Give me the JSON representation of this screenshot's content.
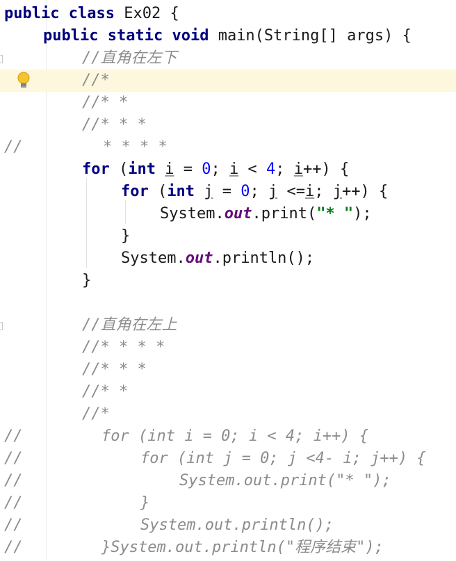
{
  "editor": {
    "lines": [
      {
        "tokens": [
          {
            "t": "public",
            "c": "kw"
          },
          {
            "t": " "
          },
          {
            "t": "class",
            "c": "kw"
          },
          {
            "t": " Ex02 {"
          }
        ]
      },
      {
        "tokens": [
          {
            "t": "public",
            "c": "kw"
          },
          {
            "t": " "
          },
          {
            "t": "static",
            "c": "kw"
          },
          {
            "t": " "
          },
          {
            "t": "void",
            "c": "kw"
          },
          {
            "t": " main(String[] args) {"
          }
        ]
      },
      {
        "tokens": [
          {
            "t": "//直角在左下",
            "c": "comment"
          }
        ]
      },
      {
        "tokens": [
          {
            "t": "//*",
            "c": "comment"
          }
        ]
      },
      {
        "tokens": [
          {
            "t": "//* *",
            "c": "comment"
          }
        ]
      },
      {
        "tokens": [
          {
            "t": "//* * *",
            "c": "comment"
          }
        ]
      },
      {
        "tokens": [
          {
            "t": "* * * *",
            "c": "comment"
          }
        ]
      },
      {
        "tokens": [
          {
            "t": "for",
            "c": "kw"
          },
          {
            "t": " ("
          },
          {
            "t": "int",
            "c": "kw"
          },
          {
            "t": " "
          },
          {
            "t": "i",
            "c": "uline"
          },
          {
            "t": " = "
          },
          {
            "t": "0",
            "c": "num"
          },
          {
            "t": "; "
          },
          {
            "t": "i",
            "c": "uline"
          },
          {
            "t": " < "
          },
          {
            "t": "4",
            "c": "num"
          },
          {
            "t": "; "
          },
          {
            "t": "i",
            "c": "uline"
          },
          {
            "t": "++) {"
          }
        ]
      },
      {
        "tokens": [
          {
            "t": "for",
            "c": "kw"
          },
          {
            "t": " ("
          },
          {
            "t": "int",
            "c": "kw"
          },
          {
            "t": " "
          },
          {
            "t": "j",
            "c": "uline"
          },
          {
            "t": " = "
          },
          {
            "t": "0",
            "c": "num"
          },
          {
            "t": "; "
          },
          {
            "t": "j",
            "c": "uline"
          },
          {
            "t": " <="
          },
          {
            "t": "i",
            "c": "uline"
          },
          {
            "t": "; "
          },
          {
            "t": "j",
            "c": "uline"
          },
          {
            "t": "++) {"
          }
        ]
      },
      {
        "tokens": [
          {
            "t": "System."
          },
          {
            "t": "out",
            "c": "field"
          },
          {
            "t": ".print("
          },
          {
            "t": "\"* \"",
            "c": "str"
          },
          {
            "t": ");"
          }
        ]
      },
      {
        "tokens": [
          {
            "t": "}"
          }
        ]
      },
      {
        "tokens": [
          {
            "t": "System."
          },
          {
            "t": "out",
            "c": "field"
          },
          {
            "t": ".println();"
          }
        ]
      },
      {
        "tokens": [
          {
            "t": "}"
          }
        ]
      },
      {
        "tokens": []
      },
      {
        "tokens": [
          {
            "t": "//直角在左上",
            "c": "comment"
          }
        ]
      },
      {
        "tokens": [
          {
            "t": "//* * * *",
            "c": "comment"
          }
        ]
      },
      {
        "tokens": [
          {
            "t": "//* * *",
            "c": "comment"
          }
        ]
      },
      {
        "tokens": [
          {
            "t": "//* *",
            "c": "comment"
          }
        ]
      },
      {
        "tokens": [
          {
            "t": "//*",
            "c": "comment"
          }
        ]
      },
      {
        "tokens": [
          {
            "t": "for (int i = 0; i < 4; i++) {",
            "c": "comment"
          }
        ]
      },
      {
        "tokens": [
          {
            "t": "for (int j = 0; j <4- i; j++) {",
            "c": "comment"
          }
        ]
      },
      {
        "tokens": [
          {
            "t": "System.out.print(\"* \");",
            "c": "comment"
          }
        ]
      },
      {
        "tokens": [
          {
            "t": "}",
            "c": "comment"
          }
        ]
      },
      {
        "tokens": [
          {
            "t": "System.out.println();",
            "c": "comment"
          }
        ]
      },
      {
        "tokens": [
          {
            "t": "}System.out.println(\"程序结束\");",
            "c": "comment"
          }
        ]
      }
    ],
    "gutter_comments": [
      {
        "line": 6,
        "text": "//"
      },
      {
        "line": 19,
        "text": "//"
      },
      {
        "line": 20,
        "text": "//"
      },
      {
        "line": 21,
        "text": "//"
      },
      {
        "line": 22,
        "text": "//"
      },
      {
        "line": 23,
        "text": "//"
      },
      {
        "line": 24,
        "text": "//"
      }
    ],
    "highlighted_line": 3,
    "intention_icon": "lightbulb-icon",
    "colors": {
      "keyword": "#000080",
      "number": "#0000ff",
      "string": "#067d17",
      "static_field": "#660e7a",
      "comment": "#8c8c8c",
      "highlight": "#fdf7dd"
    }
  }
}
